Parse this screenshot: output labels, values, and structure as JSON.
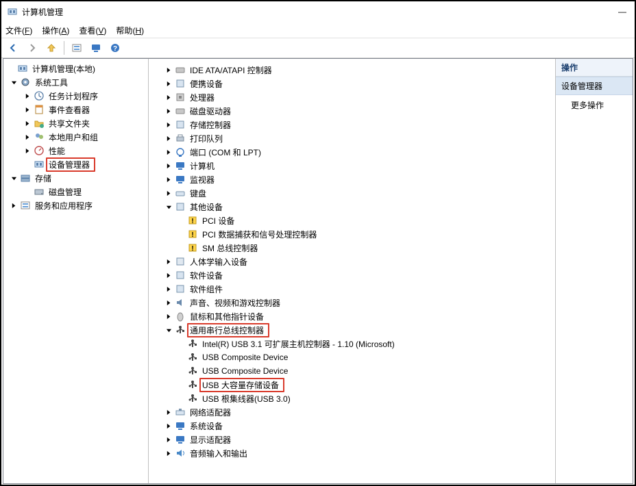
{
  "window": {
    "title": "计算机管理",
    "minimize": "—"
  },
  "menus": {
    "file": {
      "label": "文件",
      "hotkey": "F"
    },
    "action": {
      "label": "操作",
      "hotkey": "A"
    },
    "view": {
      "label": "查看",
      "hotkey": "V"
    },
    "help": {
      "label": "帮助",
      "hotkey": "H"
    }
  },
  "left_tree": {
    "root": "计算机管理(本地)",
    "sys_tools": {
      "label": "系统工具",
      "items": {
        "task_scheduler": "任务计划程序",
        "event_viewer": "事件查看器",
        "shared_folders": "共享文件夹",
        "local_users": "本地用户和组",
        "performance": "性能",
        "device_manager": "设备管理器"
      }
    },
    "storage": {
      "label": "存储",
      "disk_mgmt": "磁盘管理"
    },
    "services_apps": "服务和应用程序"
  },
  "devices": {
    "ide": "IDE ATA/ATAPI 控制器",
    "portable": "便携设备",
    "cpu": "处理器",
    "disk_drives": "磁盘驱动器",
    "storage_ctrl": "存储控制器",
    "print_queues": "打印队列",
    "ports": "端口 (COM 和 LPT)",
    "computer": "计算机",
    "monitors": "监视器",
    "keyboards": "键盘",
    "other": {
      "label": "其他设备",
      "pci": "PCI 设备",
      "pci_daq": "PCI 数据捕获和信号处理控制器",
      "sm_bus": "SM 总线控制器"
    },
    "hid": "人体学输入设备",
    "software_dev": "软件设备",
    "software_comp": "软件组件",
    "sound": "声音、视频和游戏控制器",
    "mice": "鼠标和其他指针设备",
    "usb": {
      "label": "通用串行总线控制器",
      "host": "Intel(R) USB 3.1 可扩展主机控制器 - 1.10 (Microsoft)",
      "comp1": "USB Composite Device",
      "comp2": "USB Composite Device",
      "mass": "USB 大容量存储设备",
      "roothub": "USB 根集线器(USB 3.0)"
    },
    "network": "网络适配器",
    "system": "系统设备",
    "display": "显示适配器",
    "audio_io": "音频输入和输出"
  },
  "actions": {
    "header": "操作",
    "context": "设备管理器",
    "more": "更多操作"
  }
}
